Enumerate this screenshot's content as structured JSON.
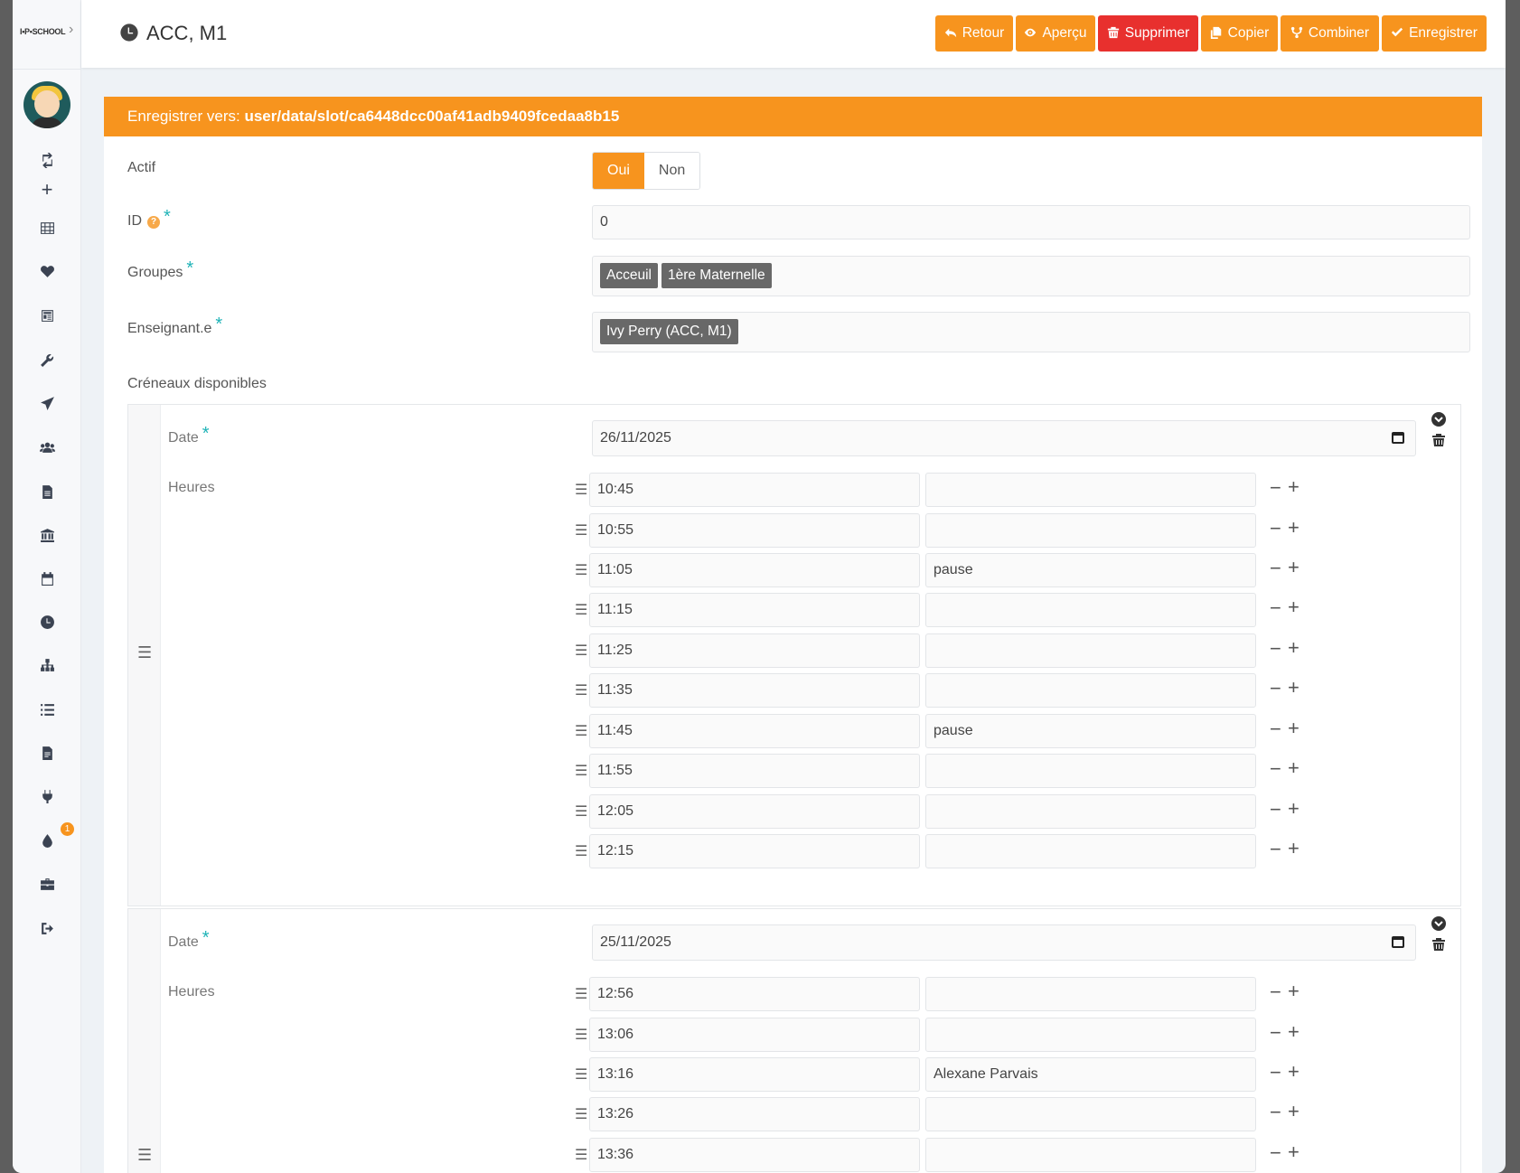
{
  "sidebar": {
    "logo_text": "I•P•SCHOOL",
    "badge_count": "1",
    "icons": [
      "swap-icon",
      "plus-icon",
      "grid-icon",
      "heart-icon",
      "newspaper-icon",
      "wrench-icon",
      "send-icon",
      "users-icon",
      "file-icon",
      "bank-icon",
      "calendar-icon",
      "clock-icon",
      "sitemap-icon",
      "list-icon",
      "document-icon",
      "plug-icon",
      "drop-icon",
      "briefcase-icon",
      "logout-icon"
    ]
  },
  "header": {
    "title": "ACC, M1",
    "buttons": {
      "back": "Retour",
      "preview": "Aperçu",
      "delete": "Supprimer",
      "copy": "Copier",
      "combine": "Combiner",
      "save": "Enregistrer"
    }
  },
  "form": {
    "save_to_label": "Enregistrer vers:",
    "save_to_path": "user/data/slot/ca6448dcc00af41adb9409fcedaa8b15",
    "active": {
      "label": "Actif",
      "yes": "Oui",
      "no": "Non",
      "selected": "Oui"
    },
    "id": {
      "label": "ID",
      "help": "?",
      "value": "0"
    },
    "groups": {
      "label": "Groupes",
      "tags": [
        "Acceuil",
        "1ère Maternelle"
      ]
    },
    "teacher": {
      "label": "Enseignant.e",
      "tags": [
        "Ivy Perry (ACC, M1)"
      ]
    },
    "required_mark": "*",
    "slots_label": "Créneaux disponibles",
    "date_label": "Date",
    "hours_label": "Heures",
    "slots": [
      {
        "date": "26/11/2025",
        "hours": [
          {
            "time": "10:45",
            "note": ""
          },
          {
            "time": "10:55",
            "note": ""
          },
          {
            "time": "11:05",
            "note": "pause"
          },
          {
            "time": "11:15",
            "note": ""
          },
          {
            "time": "11:25",
            "note": ""
          },
          {
            "time": "11:35",
            "note": ""
          },
          {
            "time": "11:45",
            "note": "pause"
          },
          {
            "time": "11:55",
            "note": ""
          },
          {
            "time": "12:05",
            "note": ""
          },
          {
            "time": "12:15",
            "note": ""
          }
        ]
      },
      {
        "date": "25/11/2025",
        "hours": [
          {
            "time": "12:56",
            "note": ""
          },
          {
            "time": "13:06",
            "note": ""
          },
          {
            "time": "13:16",
            "note": "Alexane Parvais"
          },
          {
            "time": "13:26",
            "note": ""
          },
          {
            "time": "13:36",
            "note": ""
          }
        ]
      }
    ]
  },
  "colors": {
    "accent": "#f7941e",
    "danger": "#e8302e",
    "required": "#1fb3b7"
  }
}
